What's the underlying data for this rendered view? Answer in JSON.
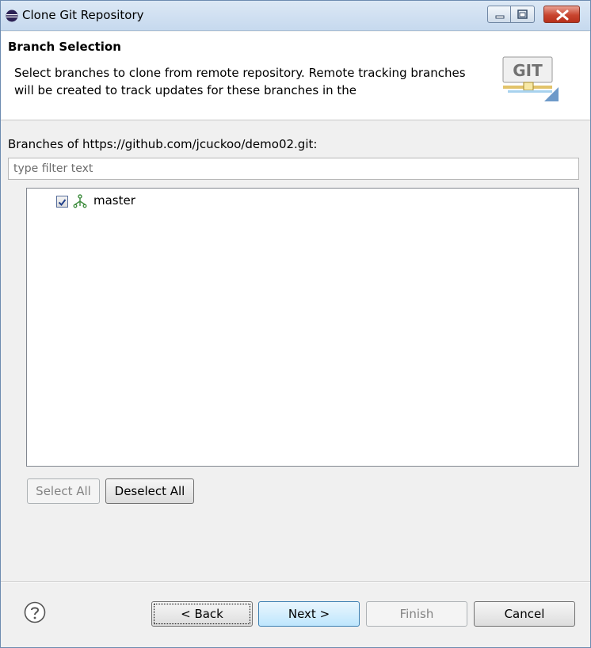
{
  "window": {
    "title": "Clone Git Repository"
  },
  "header": {
    "title": "Branch Selection",
    "description": "Select branches to clone from remote repository. Remote tracking branches will be created to track updates for these branches in the",
    "logo_text": "GIT"
  },
  "branches": {
    "label": "Branches of https://github.com/jcuckoo/demo02.git:",
    "filter_placeholder": "type filter text",
    "filter_value": "",
    "items": [
      {
        "label": "master",
        "checked": true
      }
    ],
    "select_all": "Select All",
    "deselect_all": "Deselect All"
  },
  "footer": {
    "back": "< Back",
    "next": "Next >",
    "finish": "Finish",
    "cancel": "Cancel"
  },
  "colors": {
    "titlebar": "#c6d9ee",
    "close_button": "#c8452f",
    "default_button": "#bee6fd",
    "checkbox_check": "#1f3f8a",
    "branch_icon": "#3d8c3d"
  }
}
